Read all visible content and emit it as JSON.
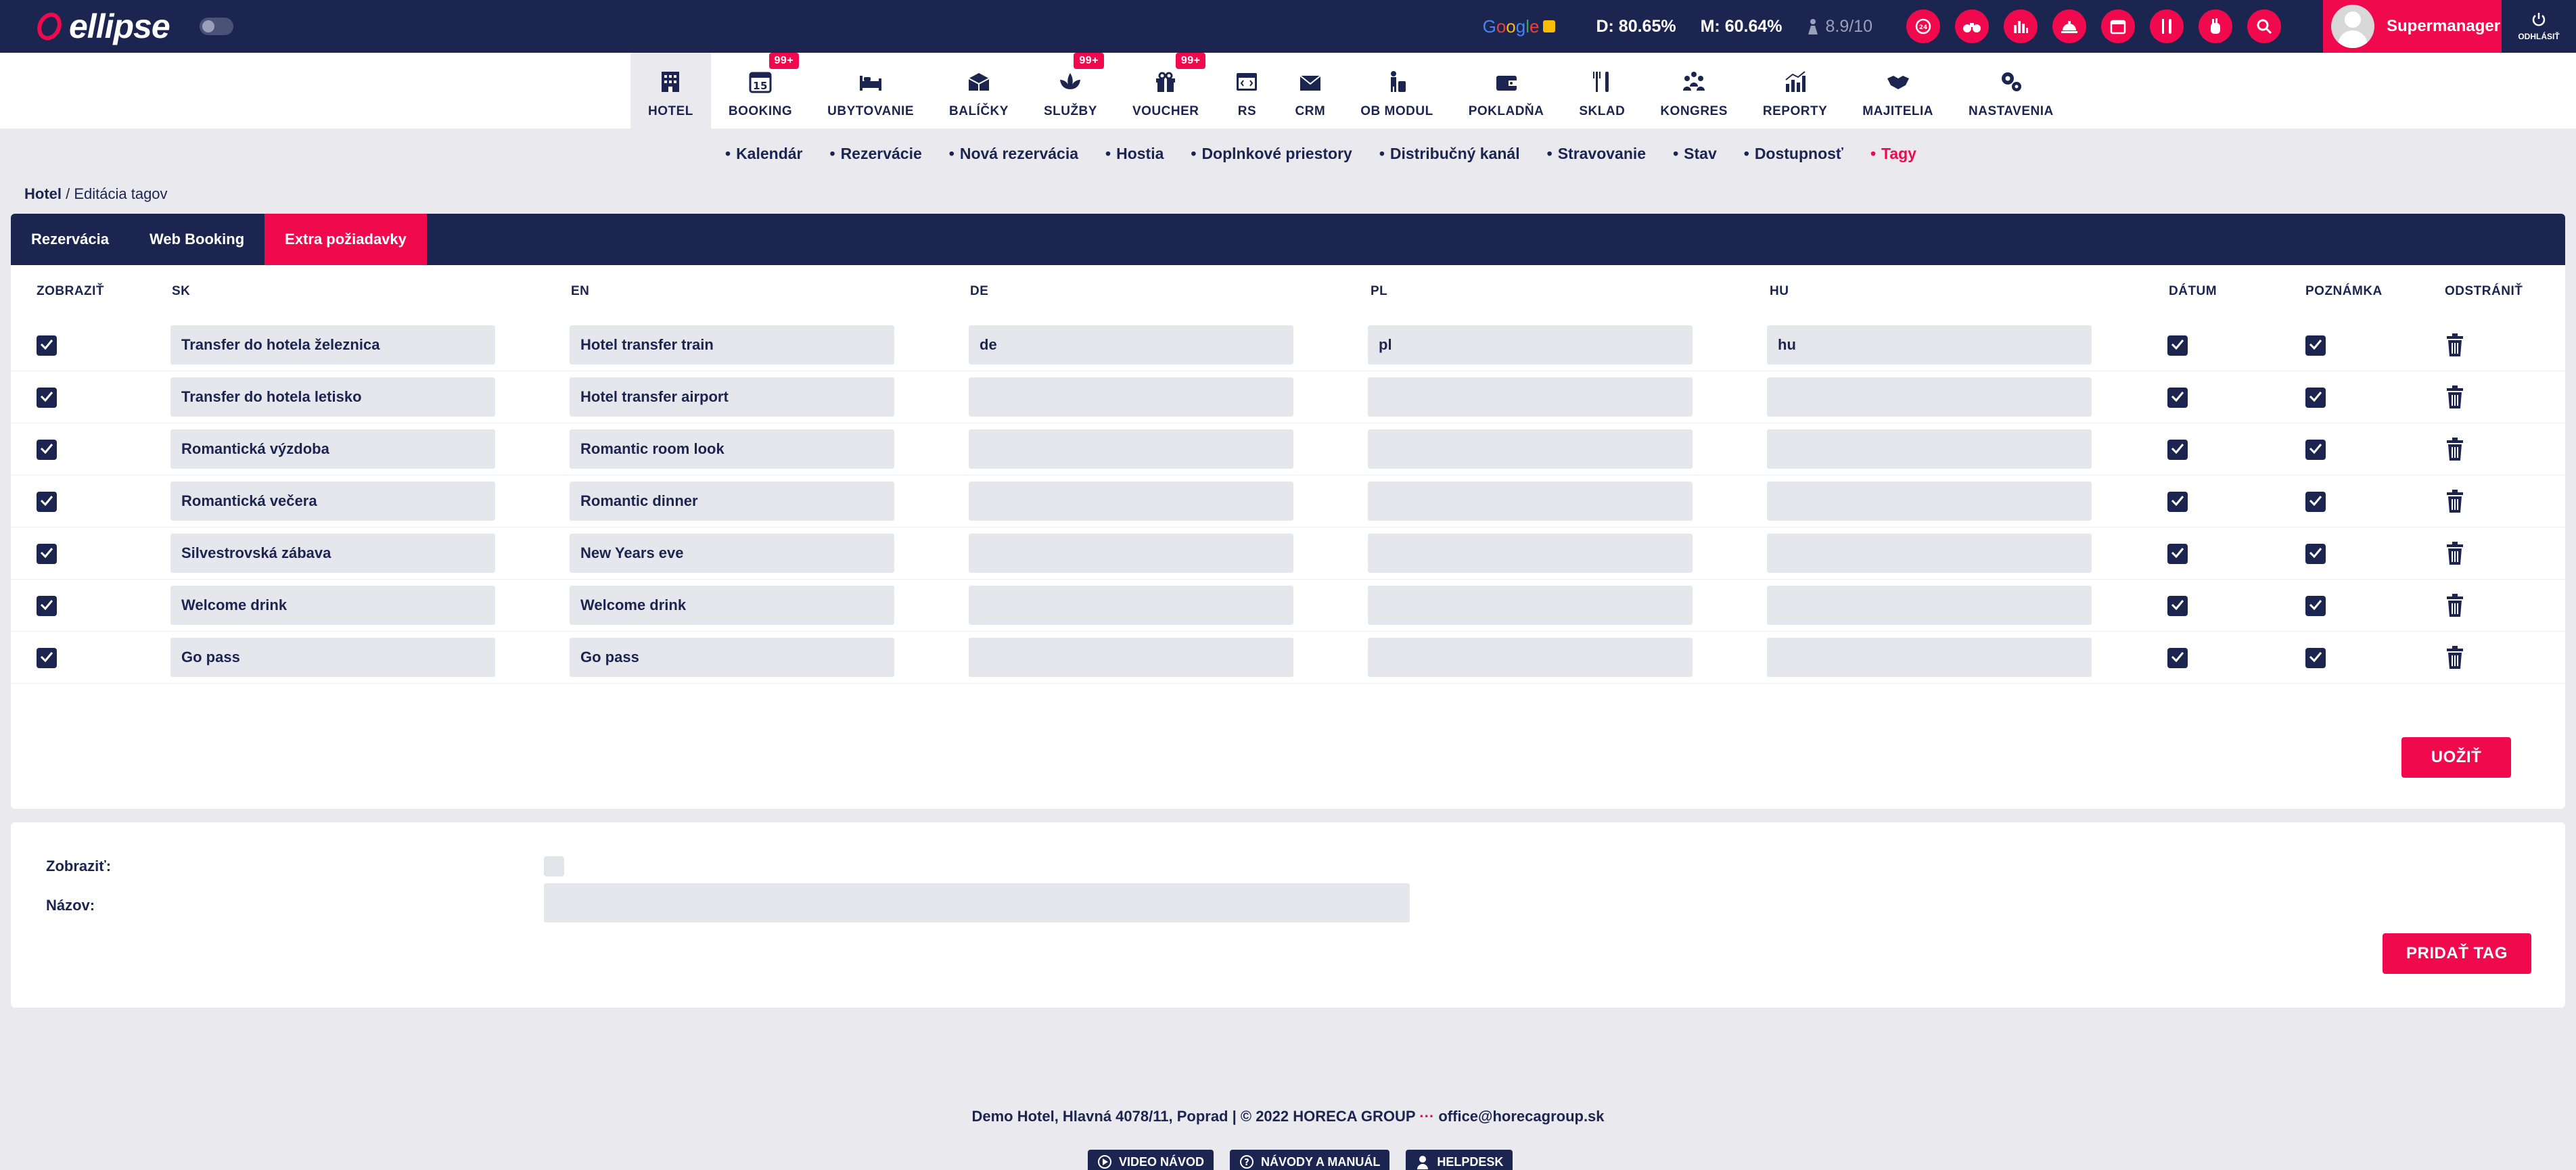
{
  "app": {
    "logo_text": "ellipse"
  },
  "topbar": {
    "google": [
      "G",
      "o",
      "o",
      "g",
      "l",
      "e"
    ],
    "stat_d": "D: 80.65%",
    "stat_m": "M: 60.64%",
    "score": "8.9/10",
    "quick_icons": [
      "24h-icon",
      "binoculars-icon",
      "bar-chart-icon",
      "service-bell-icon",
      "calendar-icon",
      "cutlery-icon",
      "hand-icon",
      "search-icon"
    ],
    "user_name": "Supermanager",
    "logout_label": "ODHLÁSIŤ"
  },
  "modules": [
    {
      "label": "HOTEL",
      "icon": "building-icon",
      "badge": "",
      "active": true
    },
    {
      "label": "BOOKING",
      "icon": "calendar-15-icon",
      "badge": "99+"
    },
    {
      "label": "UBYTOVANIE",
      "icon": "bed-icon",
      "badge": ""
    },
    {
      "label": "BALÍČKY",
      "icon": "package-icon",
      "badge": ""
    },
    {
      "label": "SLUŽBY",
      "icon": "lotus-icon",
      "badge": "99+"
    },
    {
      "label": "VOUCHER",
      "icon": "gift-icon",
      "badge": "99+"
    },
    {
      "label": "RS",
      "icon": "code-window-icon",
      "badge": ""
    },
    {
      "label": "CRM",
      "icon": "envelope-icon",
      "badge": ""
    },
    {
      "label": "OB MODUL",
      "icon": "person-luggage-icon",
      "badge": ""
    },
    {
      "label": "POKLADŇA",
      "icon": "wallet-icon",
      "badge": ""
    },
    {
      "label": "SKLAD",
      "icon": "cutlery-icon",
      "badge": ""
    },
    {
      "label": "KONGRES",
      "icon": "group-icon",
      "badge": ""
    },
    {
      "label": "REPORTY",
      "icon": "chart-icon",
      "badge": ""
    },
    {
      "label": "MAJITELIA",
      "icon": "handshake-icon",
      "badge": ""
    },
    {
      "label": "NASTAVENIA",
      "icon": "gears-icon",
      "badge": ""
    }
  ],
  "subnav": [
    "Kalendár",
    "Rezervácie",
    "Nová rezervácia",
    "Hostia",
    "Doplnkové priestory",
    "Distribučný kanál",
    "Stravovanie",
    "Stav",
    "Dostupnosť",
    "Tagy"
  ],
  "breadcrumb": {
    "root": "Hotel",
    "current": " / Editácia tagov"
  },
  "tabs": [
    "Rezervácia",
    "Web Booking",
    "Extra požiadavky"
  ],
  "table": {
    "headers": [
      "ZOBRAZIŤ",
      "SK",
      "EN",
      "DE",
      "PL",
      "HU",
      "DÁTUM",
      "POZNÁMKA",
      "ODSTRÁNIŤ"
    ],
    "rows": [
      {
        "sk": "Transfer do hotela železnica",
        "en": "Hotel transfer train",
        "de": "de",
        "pl": "pl",
        "hu": "hu",
        "show": true,
        "date": true,
        "note": true
      },
      {
        "sk": "Transfer do hotela letisko",
        "en": "Hotel transfer airport",
        "de": "",
        "pl": "",
        "hu": "",
        "show": true,
        "date": true,
        "note": true
      },
      {
        "sk": "Romantická výzdoba",
        "en": "Romantic room look",
        "de": "",
        "pl": "",
        "hu": "",
        "show": true,
        "date": true,
        "note": true
      },
      {
        "sk": "Romantická večera",
        "en": "Romantic dinner",
        "de": "",
        "pl": "",
        "hu": "",
        "show": true,
        "date": true,
        "note": true
      },
      {
        "sk": "Silvestrovská zábava",
        "en": "New Years eve",
        "de": "",
        "pl": "",
        "hu": "",
        "show": true,
        "date": true,
        "note": true
      },
      {
        "sk": "Welcome drink",
        "en": "Welcome drink",
        "de": "",
        "pl": "",
        "hu": "",
        "show": true,
        "date": true,
        "note": true
      },
      {
        "sk": "Go pass",
        "en": "Go pass",
        "de": "",
        "pl": "",
        "hu": "",
        "show": true,
        "date": true,
        "note": true
      }
    ]
  },
  "apply_button": "UOŽIŤ",
  "new_tag": {
    "show_label": "Zobraziť:",
    "name_label": "Názov:",
    "name_value": "",
    "add_button": "PRIDAŤ TAG"
  },
  "footer": {
    "text": "Demo Hotel, Hlavná 4078/11, Poprad | © 2022 HORECA GROUP",
    "dots": " ··· ",
    "email": "office@horecagroup.sk",
    "buttons": [
      "VIDEO NÁVOD",
      "NÁVODY A MANUÁL",
      "HELPDESK"
    ]
  },
  "colors": {
    "navy": "#1c2550",
    "accent": "#f0094c",
    "field": "#e6e7ec",
    "background": "#e9e9ee"
  }
}
